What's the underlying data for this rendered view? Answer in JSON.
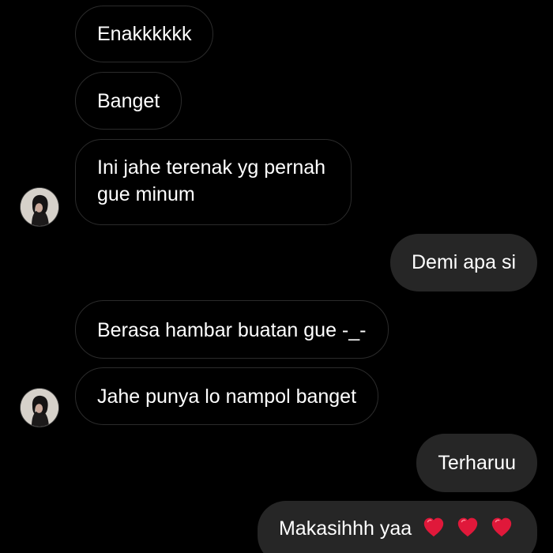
{
  "conversation": {
    "messages": [
      {
        "side": "incoming",
        "text": "Enakkkkkk"
      },
      {
        "side": "incoming",
        "text": "Banget"
      },
      {
        "side": "incoming",
        "text": "Ini jahe terenak yg pernah gue minum"
      },
      {
        "side": "outgoing",
        "text": "Demi apa si"
      },
      {
        "side": "incoming",
        "text": "Berasa hambar buatan gue -_-"
      },
      {
        "side": "incoming",
        "text": "Jahe punya lo nampol banget"
      },
      {
        "side": "outgoing",
        "text": "Terharuu"
      },
      {
        "side": "outgoing",
        "text": "Makasihhh yaa",
        "emoji": [
          "heart-icon",
          "heart-icon",
          "heart-icon"
        ]
      }
    ]
  },
  "theme": {
    "background": "#000000",
    "incoming_bubble": "#000000",
    "incoming_border": "#2b2b2b",
    "outgoing_bubble": "#262626",
    "text": "#ffffff",
    "heart": "#e0183a"
  }
}
